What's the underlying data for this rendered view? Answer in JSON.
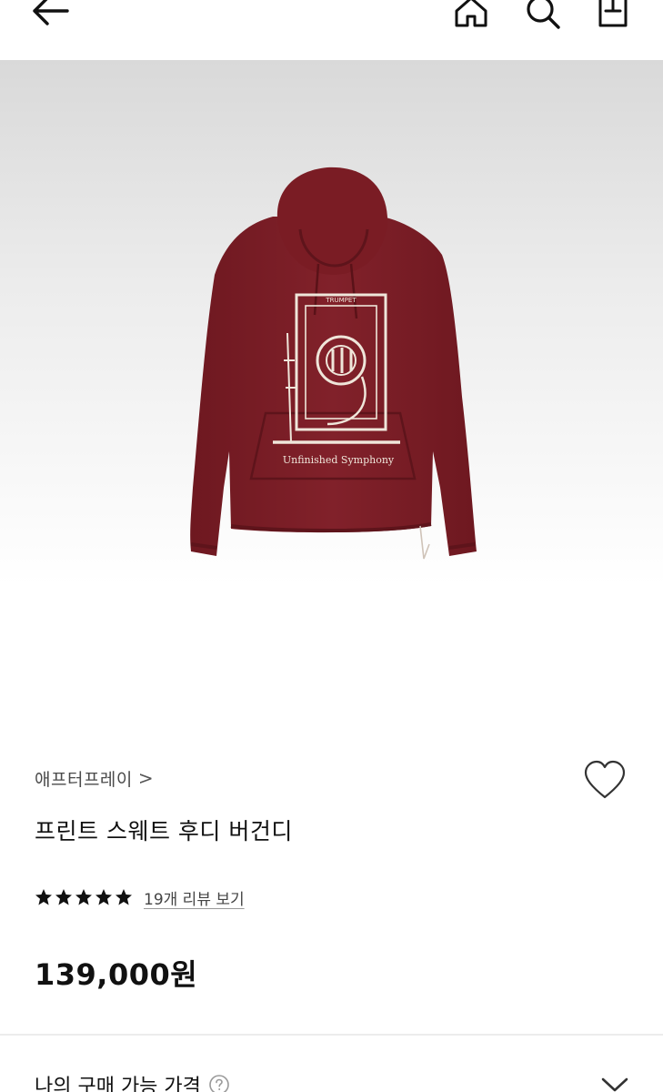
{
  "brand": {
    "name": "애프터프레이",
    "chevron": ">"
  },
  "product": {
    "title": "프린트 스웨트 후디 버건디",
    "rating": 5,
    "review_link": "19개 리뷰 보기",
    "price": "139,000원",
    "print_text": "Unfinished Symphony",
    "print_label_top": "TRUMPET",
    "print_label_side": "TRUMPET"
  },
  "my_price": {
    "label": "나의 구매 가능 가격"
  },
  "colors": {
    "hoodie": "#7d1d25",
    "print": "#efe6da",
    "text": "#111111"
  },
  "icons": {
    "back": "arrow-left-icon",
    "home": "home-icon",
    "search": "search-icon",
    "share": "share-icon",
    "wish": "heart-icon",
    "help": "question-circle-icon",
    "expand": "chevron-down-icon"
  }
}
